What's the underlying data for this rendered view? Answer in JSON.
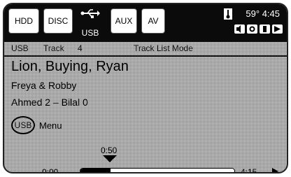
{
  "sources": {
    "hdd": "HDD",
    "disc": "DISC",
    "usb": "USB",
    "aux": "AUX",
    "av": "AV"
  },
  "status": {
    "temp": "59°",
    "time": "4:45"
  },
  "info": {
    "source": "USB",
    "track_label": "Track",
    "track_number": "4",
    "mode": "Track List Mode"
  },
  "now_playing": {
    "title": "Lion, Buying, Ryan",
    "artist": "Freya & Robby",
    "album": "Ahmed 2 – Bilal 0"
  },
  "menu": {
    "usb_button": "USB",
    "label": "Menu"
  },
  "progress": {
    "elapsed": "0:50",
    "start": "0:00",
    "end": "4:15",
    "fraction": 0.196
  }
}
